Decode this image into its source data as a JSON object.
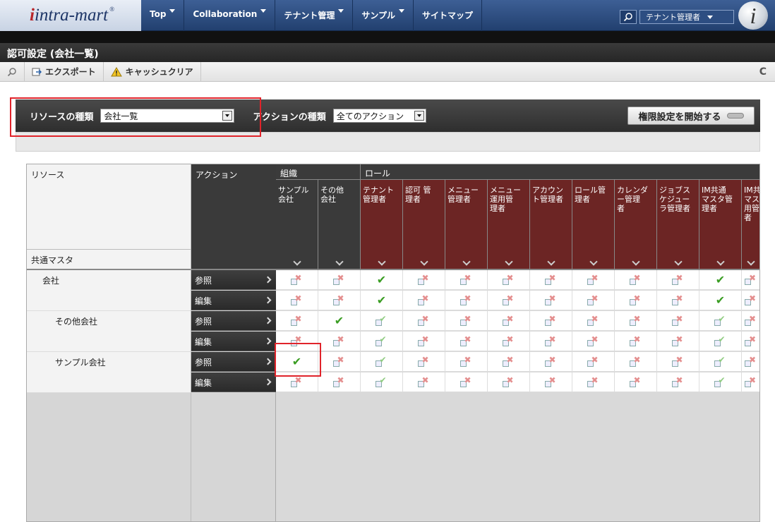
{
  "header": {
    "logo_text": "intra-mart",
    "menu": [
      {
        "label": "Top"
      },
      {
        "label": "Collaboration"
      },
      {
        "label": "テナント管理"
      },
      {
        "label": "サンプル"
      },
      {
        "label": "サイトマップ"
      }
    ],
    "user_label": "テナント管理者"
  },
  "page_title": "認可設定 (会社一覧)",
  "toolbar": {
    "export_label": "エクスポート",
    "cache_clear_label": "キャッシュクリア"
  },
  "filter": {
    "resource_type_label": "リソースの種類",
    "resource_type_value": "会社一覧",
    "action_type_label": "アクションの種類",
    "action_type_value": "全てのアクション",
    "start_button_label": "権限設定を開始する"
  },
  "grid": {
    "resource_header": "リソース",
    "action_header": "アクション",
    "common_master_label": "共通マスタ",
    "group_org_label": "組織",
    "group_role_label": "ロール",
    "columns": [
      {
        "label": "サンプル\n会社",
        "group": "org"
      },
      {
        "label": "その他\n会社",
        "group": "org"
      },
      {
        "label": "テナント\n管理者",
        "group": "role"
      },
      {
        "label": "認可 管\n理者",
        "group": "role"
      },
      {
        "label": "メニュー\n管理者",
        "group": "role"
      },
      {
        "label": "メニュー\n運用管\n理者",
        "group": "role"
      },
      {
        "label": "アカウン\nト管理者",
        "group": "role"
      },
      {
        "label": "ロール管\n理者",
        "group": "role"
      },
      {
        "label": "カレンダ\nー管理\n者",
        "group": "role"
      },
      {
        "label": "ジョブス\nケジュー\nラ管理者",
        "group": "role"
      },
      {
        "label": "IM共通\nマスタ管\n理者",
        "group": "role"
      },
      {
        "label": "IM共\nマス\n用管\n者",
        "group": "role"
      }
    ],
    "rows": [
      {
        "resource": "会社",
        "indent": 1,
        "action": "参照",
        "cells": [
          "dx",
          "dx",
          "check",
          "dx",
          "dx",
          "dx",
          "dx",
          "dx",
          "dx",
          "dx",
          "check",
          "dx"
        ]
      },
      {
        "resource": "",
        "indent": 1,
        "action": "編集",
        "cells": [
          "dx",
          "dx",
          "check",
          "dx",
          "dx",
          "dx",
          "dx",
          "dx",
          "dx",
          "dx",
          "check",
          "dx"
        ]
      },
      {
        "resource": "その他会社",
        "indent": 2,
        "action": "参照",
        "cells": [
          "dx",
          "check",
          "dc",
          "dx",
          "dx",
          "dx",
          "dx",
          "dx",
          "dx",
          "dx",
          "dc",
          "dx"
        ]
      },
      {
        "resource": "",
        "indent": 2,
        "action": "編集",
        "cells": [
          "dx",
          "dx",
          "dc",
          "dx",
          "dx",
          "dx",
          "dx",
          "dx",
          "dx",
          "dx",
          "dc",
          "dx"
        ]
      },
      {
        "resource": "サンプル会社",
        "indent": 2,
        "action": "参照",
        "cells": [
          "check",
          "dx",
          "dc",
          "dx",
          "dx",
          "dx",
          "dx",
          "dx",
          "dx",
          "dx",
          "dc",
          "dx"
        ]
      },
      {
        "resource": "",
        "indent": 2,
        "action": "編集",
        "cells": [
          "dx",
          "dx",
          "dc",
          "dx",
          "dx",
          "dx",
          "dx",
          "dx",
          "dx",
          "dx",
          "dc",
          "dx"
        ]
      }
    ]
  }
}
